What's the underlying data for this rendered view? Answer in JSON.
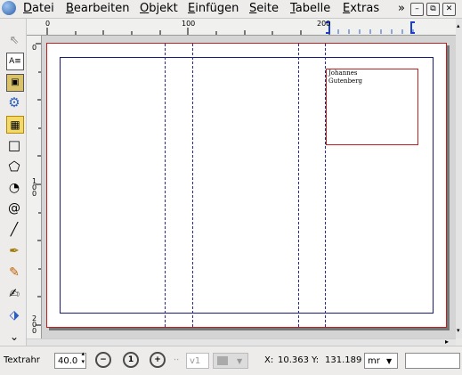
{
  "menubar": {
    "items": [
      "Datei",
      "Bearbeiten",
      "Objekt",
      "Einfügen",
      "Seite",
      "Tabelle",
      "Extras"
    ],
    "overflow": "»"
  },
  "window_buttons": {
    "minimize": "–",
    "restore": "⧉",
    "close": "✕"
  },
  "toolbox": {
    "tools": [
      "select-icon",
      "text-frame-icon",
      "image-frame-icon",
      "render-frame-icon",
      "table-icon",
      "shape-icon",
      "polygon-icon",
      "arc-icon",
      "spiral-icon",
      "line-icon",
      "bezier-icon",
      "freehand-icon",
      "calligraphy-icon",
      "rotate-icon",
      "more-tools-icon"
    ]
  },
  "rulers": {
    "h_labels": [
      "0",
      "100",
      "200"
    ],
    "v_labels": [
      "0",
      "1\n0\n0",
      "2\n0\n0"
    ]
  },
  "text_frame": {
    "content": "Johannes\nGutenberg"
  },
  "statusbar": {
    "mode_label": "Textrahr",
    "zoom_value": "40.0",
    "zoom_out_icon": "zoom-out-icon",
    "zoom_100_icon": "zoom-100-icon",
    "zoom_in_icon": "zoom-in-icon",
    "page_value": "v1",
    "coord_x_label": "X:",
    "coord_x_value": "10.363",
    "coord_y_label": "Y:",
    "coord_y_value": "131.189",
    "unit": "mr"
  },
  "colors": {
    "page_border": "#c02020",
    "guides": "#1a1a7a",
    "frame": "#c02020"
  }
}
